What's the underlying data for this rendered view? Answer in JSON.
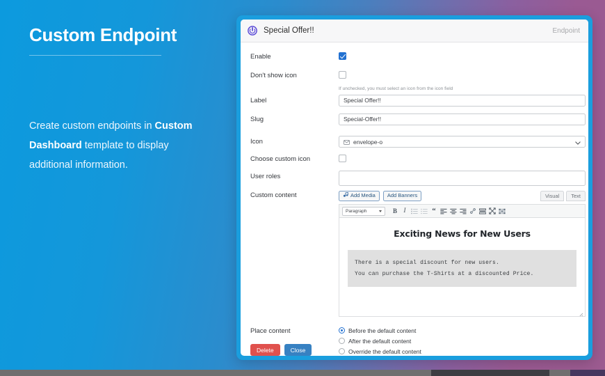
{
  "promo": {
    "title": "Custom Endpoint",
    "body_part1": "Create custom endpoints in ",
    "body_strong": "Custom Dashboard",
    "body_part2": " template to display additional information."
  },
  "modal": {
    "power_icon": "power-icon",
    "title": "Special Offer!!",
    "badge": "Endpoint",
    "fields": {
      "enable": {
        "label": "Enable",
        "checked": true
      },
      "dont_show_icon": {
        "label": "Don't show icon",
        "checked": false,
        "hint": "If unchecked, you must select an icon from the icon field"
      },
      "label": {
        "label": "Label",
        "value": "Special Offer!!",
        "placeholder": ""
      },
      "slug": {
        "label": "Slug",
        "value": "Special-Offer!!",
        "placeholder": ""
      },
      "icon": {
        "label": "Icon",
        "selected": "envelope-o",
        "icon_glyph": "envelope-icon",
        "chevron": "chevron-down-icon"
      },
      "choose_custom_icon": {
        "label": "Choose custom icon",
        "checked": false
      },
      "user_roles": {
        "label": "User roles",
        "value": "",
        "placeholder": ""
      },
      "custom_content": {
        "label": "Custom content"
      },
      "place_content": {
        "label": "Place content"
      }
    },
    "editor": {
      "add_media": "Add Media",
      "add_media_icon": "media-icon",
      "add_banners": "Add Banners",
      "tab_visual": "Visual",
      "tab_text": "Text",
      "format_select": "Paragraph",
      "toolbar_icons": [
        "bold-icon",
        "italic-icon",
        "bulleted-list-icon",
        "numbered-list-icon",
        "blockquote-icon",
        "align-left-icon",
        "align-center-icon",
        "align-right-icon",
        "link-icon",
        "read-more-icon",
        "fullscreen-icon",
        "toolbar-toggle-icon"
      ],
      "content_heading": "Exciting News for New Users",
      "content_pre_line1": "There is a special discount for new users.",
      "content_pre_line2": "You can purchase the T-Shirts at a discounted Price.",
      "resize_handle": "resize-handle-icon"
    },
    "place_options": [
      {
        "label": "Before the default content",
        "selected": true
      },
      {
        "label": "After the default content",
        "selected": false
      },
      {
        "label": "Override the default content",
        "selected": false
      }
    ],
    "buttons": {
      "delete": "Delete",
      "close": "Close"
    }
  },
  "colors": {
    "background_left": "#0c9ade",
    "background_right": "#9c5b90",
    "modal_border": "#1a9ede",
    "accent_checkbox": "#2271d1",
    "delete_button": "#e0514d",
    "close_button": "#3781c2",
    "power_icon": "#5b4bd6"
  }
}
